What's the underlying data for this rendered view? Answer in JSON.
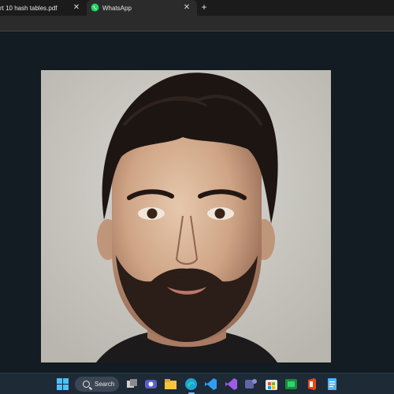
{
  "tabs": [
    {
      "label": "rt 10 hash tables.pdf",
      "active": false
    },
    {
      "label": "WhatsApp",
      "active": true
    }
  ],
  "new_tab_symbol": "+",
  "close_symbol": "✕",
  "taskbar": {
    "search_label": "Search",
    "icons": [
      "windows-start-icon",
      "search-icon",
      "task-view-icon",
      "meet-icon",
      "file-explorer-icon",
      "edge-icon",
      "vscode-icon",
      "visual-studio-icon",
      "teams-icon",
      "microsoft-store-icon",
      "photos-icon",
      "office-icon",
      "notepad-icon"
    ]
  },
  "colors": {
    "whatsapp_green": "#25D366",
    "accent": "#7bb7ff",
    "taskbar_bg": "#1e2a36"
  }
}
